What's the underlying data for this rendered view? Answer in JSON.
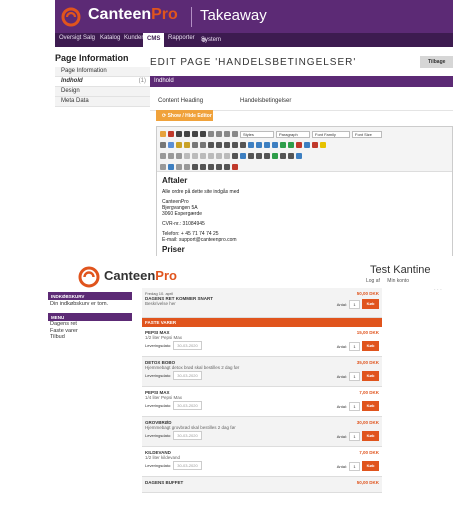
{
  "colors": {
    "brand_purple": "#5c2a75",
    "brand_orange": "#e0541d",
    "toggle_orange": "#f0a23b"
  },
  "cms": {
    "brand_main": "Canteen",
    "brand_pro": "Pro",
    "app_title": "Takeaway",
    "nav": [
      "Oversigt",
      "Salg",
      "Katalog",
      "Kunder",
      "CMS",
      "Rapporter",
      "System"
    ],
    "nav_active": "CMS",
    "side_title": "Page Information",
    "side_items": [
      {
        "label": "Page Information",
        "count": ""
      },
      {
        "label": "Indhold",
        "count": "(1)"
      },
      {
        "label": "Design",
        "count": ""
      },
      {
        "label": "Meta Data",
        "count": ""
      }
    ],
    "page_title": "EDIT PAGE 'HANDELSBETINGELSER'",
    "back_label": "Tilbage",
    "panel_head": "Indhold",
    "field_label": "Content Heading",
    "field_value": "Handelsbetingelser",
    "toggle_label": "Show / Hide Editor",
    "toolbar": {
      "styles": "Styles",
      "paragraph": "Paragraph",
      "font_family": "Font Family",
      "font_size": "Font Size"
    },
    "doc": {
      "heading": "Aftaler",
      "intro": "Alle ordre på dette site indgås med",
      "addr1": "CanteenPro",
      "addr2": "Bjergvangen 5A",
      "addr3": "3060 Espergærde",
      "cvr": "CVR-nr.: 31084945",
      "phone": "Telefon: + 45 71 74 74 25",
      "email": "E-mail: support@canteenpro.com",
      "heading2": "Priser"
    }
  },
  "shop": {
    "brand_main": "Canteen",
    "brand_pro": "Pro",
    "title": "Test Kantine",
    "links": [
      "Log af",
      "Min konto"
    ],
    "side": {
      "hdr1": "INDKØBSKURV",
      "cart_text": "Din indkøbskurv er tom.",
      "hdr2": "MENU",
      "menu": [
        "Dagens ret",
        "Faste varer",
        "Tilbud"
      ]
    },
    "featured": {
      "date": "Fredag 10. april",
      "name": "DAGENS RET KOMMER SNART",
      "desc": "Beskrivelse her",
      "price": "50,00 DKK",
      "qty_label": "Antal:",
      "qty": "1",
      "buy": "Køb"
    },
    "section": "FASTE VARER",
    "deliv_label": "Leveringsdato:",
    "deliv_date": "30-03-2020",
    "items": [
      {
        "name": "PEPSI MAX",
        "desc": "1/2 liter Pepsi Max",
        "price": "15,00 DKK"
      },
      {
        "name": "DETOX BOBO",
        "desc": "Hjemmebagt detox brød skal bestilles 2 dag før",
        "price": "35,00 DKK"
      },
      {
        "name": "PEPSI MAX",
        "desc": "1/4 liter Pepsi Max",
        "price": "7,00 DKK"
      },
      {
        "name": "GROVBRØD",
        "desc": "Hjemmebagt grovbrød skal bestilles 2 dag før",
        "price": "30,00 DKK"
      },
      {
        "name": "KILDEVAND",
        "desc": "1/2 liter kildevand",
        "price": "7,00 DKK"
      },
      {
        "name": "DAGENS BUFFET",
        "desc": "",
        "price": "50,00 DKK"
      }
    ]
  }
}
